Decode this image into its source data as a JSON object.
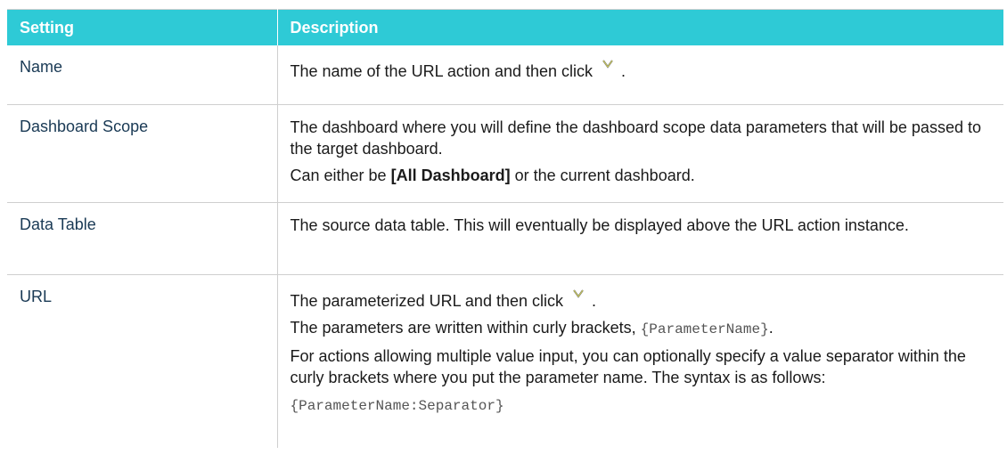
{
  "table": {
    "headers": {
      "setting": "Setting",
      "description": "Description"
    },
    "rows": {
      "name": {
        "setting": "Name",
        "desc_before_icon": "The name of the URL action and then click",
        "desc_after_icon": "."
      },
      "dashboard_scope": {
        "setting": "Dashboard Scope",
        "desc_p1": "The dashboard where you will define the dashboard scope data parameters that will be passed to the target dashboard.",
        "desc_p2_prefix": "Can either be ",
        "desc_p2_bold": "[All Dashboard]",
        "desc_p2_suffix": " or the current dashboard."
      },
      "data_table": {
        "setting": "Data Table",
        "desc_p1": "The source data table. This will eventually be displayed above the URL action instance."
      },
      "url": {
        "setting": "URL",
        "desc_before_icon": "The parameterized URL and then click",
        "desc_after_icon": ".",
        "desc_p2_prefix": "The parameters are written within curly brackets, ",
        "desc_p2_code": "{ParameterName}",
        "desc_p2_suffix": ".",
        "desc_p3": "For actions allowing multiple value input, you can optionally specify a value separator within the curly brackets where you put the parameter name. The syntax is as follows:",
        "desc_p4_code": "{ParameterName:Separator}"
      }
    }
  },
  "icons": {
    "confirm": "check-icon"
  },
  "colors": {
    "header_bg": "#2ecad6",
    "header_text": "#ffffff",
    "setting_text": "#1a3a55",
    "code_text": "#555555"
  }
}
